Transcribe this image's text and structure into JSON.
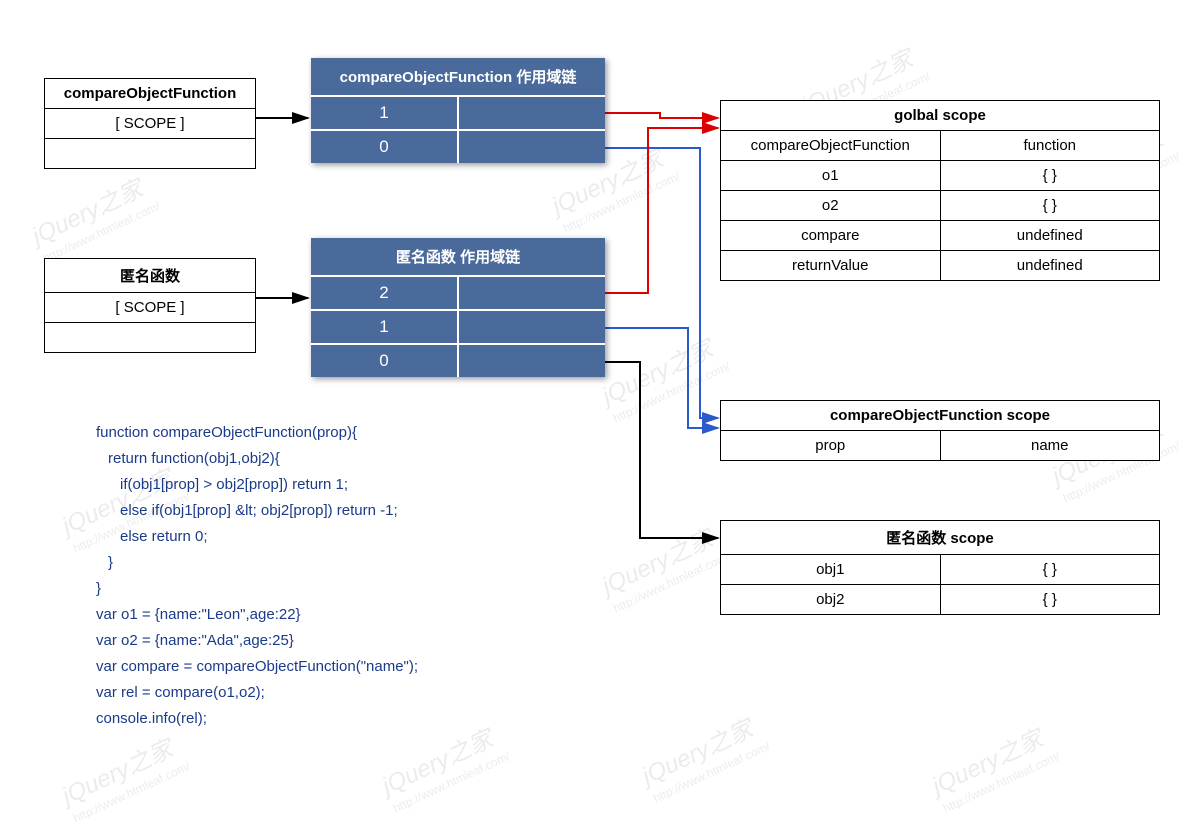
{
  "watermark": {
    "big": "jQuery之家",
    "small": "http://www.htmleaf.com/"
  },
  "compareObjBox": {
    "title": "compareObjectFunction",
    "row": "[ SCOPE ]"
  },
  "anonBox": {
    "title": "匿名函数",
    "row": "[ SCOPE ]"
  },
  "chain1": {
    "title": "compareObjectFunction 作用域链",
    "r0": "1",
    "r1": "0"
  },
  "chain2": {
    "title": "匿名函数 作用域链",
    "r0": "2",
    "r1": "1",
    "r2": "0"
  },
  "globalScope": {
    "title": "golbal scope",
    "rows": [
      [
        "compareObjectFunction",
        "function"
      ],
      [
        "o1",
        "{ }"
      ],
      [
        "o2",
        "{ }"
      ],
      [
        "compare",
        "undefined"
      ],
      [
        "returnValue",
        "undefined"
      ]
    ]
  },
  "cofScope": {
    "title": "compareObjectFunction scope",
    "rows": [
      [
        "prop",
        "name"
      ]
    ]
  },
  "anonScope": {
    "title": "匿名函数 scope",
    "rows": [
      [
        "obj1",
        "{ }"
      ],
      [
        "obj2",
        "{ }"
      ]
    ]
  },
  "code": {
    "l1": "function compareObjectFunction(prop){",
    "l2": "return function(obj1,obj2){",
    "l3": "if(obj1[prop] > obj2[prop]) return 1;",
    "l4": "else if(obj1[prop] &lt; obj2[prop]) return -1;",
    "l5": "else return 0;",
    "l6": "}",
    "l7": "}",
    "l8": "var o1 = {name:\"Leon\",age:22}",
    "l9": "var o2 = {name:\"Ada\",age:25}",
    "l10": "var compare = compareObjectFunction(\"name\");",
    "l11": "var rel = compare(o1,o2);",
    "l12": "console.info(rel);"
  }
}
